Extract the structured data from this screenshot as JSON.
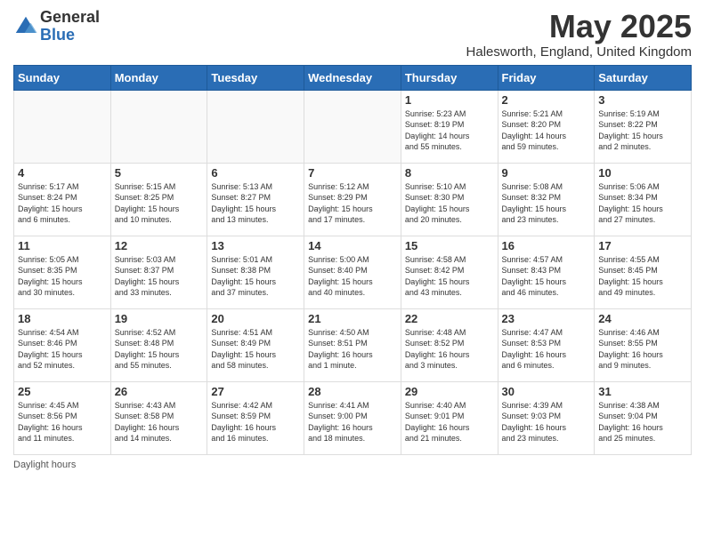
{
  "logo": {
    "general": "General",
    "blue": "Blue"
  },
  "title": "May 2025",
  "location": "Halesworth, England, United Kingdom",
  "days_of_week": [
    "Sunday",
    "Monday",
    "Tuesday",
    "Wednesday",
    "Thursday",
    "Friday",
    "Saturday"
  ],
  "footer": {
    "daylight_label": "Daylight hours"
  },
  "weeks": [
    [
      {
        "day": "",
        "info": ""
      },
      {
        "day": "",
        "info": ""
      },
      {
        "day": "",
        "info": ""
      },
      {
        "day": "",
        "info": ""
      },
      {
        "day": "1",
        "info": "Sunrise: 5:23 AM\nSunset: 8:19 PM\nDaylight: 14 hours\nand 55 minutes."
      },
      {
        "day": "2",
        "info": "Sunrise: 5:21 AM\nSunset: 8:20 PM\nDaylight: 14 hours\nand 59 minutes."
      },
      {
        "day": "3",
        "info": "Sunrise: 5:19 AM\nSunset: 8:22 PM\nDaylight: 15 hours\nand 2 minutes."
      }
    ],
    [
      {
        "day": "4",
        "info": "Sunrise: 5:17 AM\nSunset: 8:24 PM\nDaylight: 15 hours\nand 6 minutes."
      },
      {
        "day": "5",
        "info": "Sunrise: 5:15 AM\nSunset: 8:25 PM\nDaylight: 15 hours\nand 10 minutes."
      },
      {
        "day": "6",
        "info": "Sunrise: 5:13 AM\nSunset: 8:27 PM\nDaylight: 15 hours\nand 13 minutes."
      },
      {
        "day": "7",
        "info": "Sunrise: 5:12 AM\nSunset: 8:29 PM\nDaylight: 15 hours\nand 17 minutes."
      },
      {
        "day": "8",
        "info": "Sunrise: 5:10 AM\nSunset: 8:30 PM\nDaylight: 15 hours\nand 20 minutes."
      },
      {
        "day": "9",
        "info": "Sunrise: 5:08 AM\nSunset: 8:32 PM\nDaylight: 15 hours\nand 23 minutes."
      },
      {
        "day": "10",
        "info": "Sunrise: 5:06 AM\nSunset: 8:34 PM\nDaylight: 15 hours\nand 27 minutes."
      }
    ],
    [
      {
        "day": "11",
        "info": "Sunrise: 5:05 AM\nSunset: 8:35 PM\nDaylight: 15 hours\nand 30 minutes."
      },
      {
        "day": "12",
        "info": "Sunrise: 5:03 AM\nSunset: 8:37 PM\nDaylight: 15 hours\nand 33 minutes."
      },
      {
        "day": "13",
        "info": "Sunrise: 5:01 AM\nSunset: 8:38 PM\nDaylight: 15 hours\nand 37 minutes."
      },
      {
        "day": "14",
        "info": "Sunrise: 5:00 AM\nSunset: 8:40 PM\nDaylight: 15 hours\nand 40 minutes."
      },
      {
        "day": "15",
        "info": "Sunrise: 4:58 AM\nSunset: 8:42 PM\nDaylight: 15 hours\nand 43 minutes."
      },
      {
        "day": "16",
        "info": "Sunrise: 4:57 AM\nSunset: 8:43 PM\nDaylight: 15 hours\nand 46 minutes."
      },
      {
        "day": "17",
        "info": "Sunrise: 4:55 AM\nSunset: 8:45 PM\nDaylight: 15 hours\nand 49 minutes."
      }
    ],
    [
      {
        "day": "18",
        "info": "Sunrise: 4:54 AM\nSunset: 8:46 PM\nDaylight: 15 hours\nand 52 minutes."
      },
      {
        "day": "19",
        "info": "Sunrise: 4:52 AM\nSunset: 8:48 PM\nDaylight: 15 hours\nand 55 minutes."
      },
      {
        "day": "20",
        "info": "Sunrise: 4:51 AM\nSunset: 8:49 PM\nDaylight: 15 hours\nand 58 minutes."
      },
      {
        "day": "21",
        "info": "Sunrise: 4:50 AM\nSunset: 8:51 PM\nDaylight: 16 hours\nand 1 minute."
      },
      {
        "day": "22",
        "info": "Sunrise: 4:48 AM\nSunset: 8:52 PM\nDaylight: 16 hours\nand 3 minutes."
      },
      {
        "day": "23",
        "info": "Sunrise: 4:47 AM\nSunset: 8:53 PM\nDaylight: 16 hours\nand 6 minutes."
      },
      {
        "day": "24",
        "info": "Sunrise: 4:46 AM\nSunset: 8:55 PM\nDaylight: 16 hours\nand 9 minutes."
      }
    ],
    [
      {
        "day": "25",
        "info": "Sunrise: 4:45 AM\nSunset: 8:56 PM\nDaylight: 16 hours\nand 11 minutes."
      },
      {
        "day": "26",
        "info": "Sunrise: 4:43 AM\nSunset: 8:58 PM\nDaylight: 16 hours\nand 14 minutes."
      },
      {
        "day": "27",
        "info": "Sunrise: 4:42 AM\nSunset: 8:59 PM\nDaylight: 16 hours\nand 16 minutes."
      },
      {
        "day": "28",
        "info": "Sunrise: 4:41 AM\nSunset: 9:00 PM\nDaylight: 16 hours\nand 18 minutes."
      },
      {
        "day": "29",
        "info": "Sunrise: 4:40 AM\nSunset: 9:01 PM\nDaylight: 16 hours\nand 21 minutes."
      },
      {
        "day": "30",
        "info": "Sunrise: 4:39 AM\nSunset: 9:03 PM\nDaylight: 16 hours\nand 23 minutes."
      },
      {
        "day": "31",
        "info": "Sunrise: 4:38 AM\nSunset: 9:04 PM\nDaylight: 16 hours\nand 25 minutes."
      }
    ]
  ]
}
